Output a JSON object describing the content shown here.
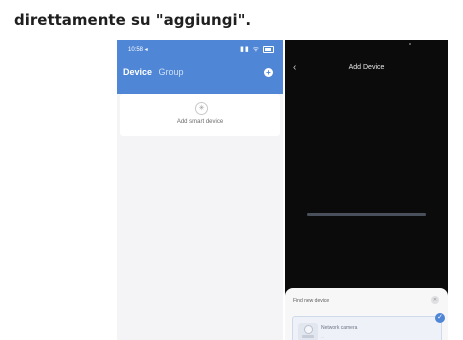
{
  "caption": "direttamente su \"aggiungi\".",
  "left_phone": {
    "status_time": "10:58 ◂",
    "status_icons": "▮▮ ᯤ",
    "tabs": [
      {
        "label": "Device",
        "active": true
      },
      {
        "label": "Group",
        "active": false
      }
    ],
    "add_symbol": "+",
    "add_card_icon": "✳",
    "add_card_label": "Add smart device",
    "header_color": "#4f86d6"
  },
  "right_phone": {
    "back_symbol": "‹",
    "title": "Add Device",
    "progress": 1.0,
    "sheet_title": "Find new device",
    "sheet_close": "✕",
    "found_device": {
      "name": "Network camera",
      "subtitle": "...",
      "check": "✓"
    }
  }
}
